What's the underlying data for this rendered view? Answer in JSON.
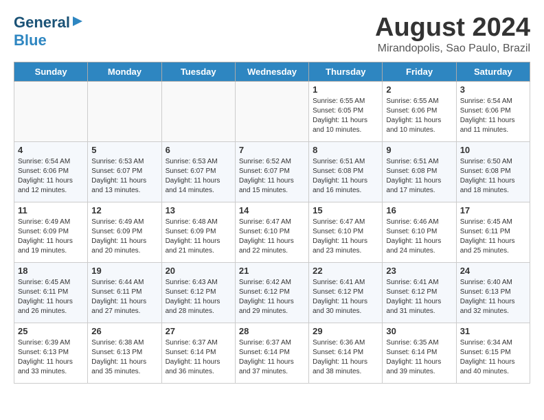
{
  "logo": {
    "line1": "General",
    "line2": "Blue"
  },
  "title": "August 2024",
  "location": "Mirandopolis, Sao Paulo, Brazil",
  "days_of_week": [
    "Sunday",
    "Monday",
    "Tuesday",
    "Wednesday",
    "Thursday",
    "Friday",
    "Saturday"
  ],
  "weeks": [
    [
      {
        "num": "",
        "info": ""
      },
      {
        "num": "",
        "info": ""
      },
      {
        "num": "",
        "info": ""
      },
      {
        "num": "",
        "info": ""
      },
      {
        "num": "1",
        "info": "Sunrise: 6:55 AM\nSunset: 6:05 PM\nDaylight: 11 hours\nand 10 minutes."
      },
      {
        "num": "2",
        "info": "Sunrise: 6:55 AM\nSunset: 6:06 PM\nDaylight: 11 hours\nand 10 minutes."
      },
      {
        "num": "3",
        "info": "Sunrise: 6:54 AM\nSunset: 6:06 PM\nDaylight: 11 hours\nand 11 minutes."
      }
    ],
    [
      {
        "num": "4",
        "info": "Sunrise: 6:54 AM\nSunset: 6:06 PM\nDaylight: 11 hours\nand 12 minutes."
      },
      {
        "num": "5",
        "info": "Sunrise: 6:53 AM\nSunset: 6:07 PM\nDaylight: 11 hours\nand 13 minutes."
      },
      {
        "num": "6",
        "info": "Sunrise: 6:53 AM\nSunset: 6:07 PM\nDaylight: 11 hours\nand 14 minutes."
      },
      {
        "num": "7",
        "info": "Sunrise: 6:52 AM\nSunset: 6:07 PM\nDaylight: 11 hours\nand 15 minutes."
      },
      {
        "num": "8",
        "info": "Sunrise: 6:51 AM\nSunset: 6:08 PM\nDaylight: 11 hours\nand 16 minutes."
      },
      {
        "num": "9",
        "info": "Sunrise: 6:51 AM\nSunset: 6:08 PM\nDaylight: 11 hours\nand 17 minutes."
      },
      {
        "num": "10",
        "info": "Sunrise: 6:50 AM\nSunset: 6:08 PM\nDaylight: 11 hours\nand 18 minutes."
      }
    ],
    [
      {
        "num": "11",
        "info": "Sunrise: 6:49 AM\nSunset: 6:09 PM\nDaylight: 11 hours\nand 19 minutes."
      },
      {
        "num": "12",
        "info": "Sunrise: 6:49 AM\nSunset: 6:09 PM\nDaylight: 11 hours\nand 20 minutes."
      },
      {
        "num": "13",
        "info": "Sunrise: 6:48 AM\nSunset: 6:09 PM\nDaylight: 11 hours\nand 21 minutes."
      },
      {
        "num": "14",
        "info": "Sunrise: 6:47 AM\nSunset: 6:10 PM\nDaylight: 11 hours\nand 22 minutes."
      },
      {
        "num": "15",
        "info": "Sunrise: 6:47 AM\nSunset: 6:10 PM\nDaylight: 11 hours\nand 23 minutes."
      },
      {
        "num": "16",
        "info": "Sunrise: 6:46 AM\nSunset: 6:10 PM\nDaylight: 11 hours\nand 24 minutes."
      },
      {
        "num": "17",
        "info": "Sunrise: 6:45 AM\nSunset: 6:11 PM\nDaylight: 11 hours\nand 25 minutes."
      }
    ],
    [
      {
        "num": "18",
        "info": "Sunrise: 6:45 AM\nSunset: 6:11 PM\nDaylight: 11 hours\nand 26 minutes."
      },
      {
        "num": "19",
        "info": "Sunrise: 6:44 AM\nSunset: 6:11 PM\nDaylight: 11 hours\nand 27 minutes."
      },
      {
        "num": "20",
        "info": "Sunrise: 6:43 AM\nSunset: 6:12 PM\nDaylight: 11 hours\nand 28 minutes."
      },
      {
        "num": "21",
        "info": "Sunrise: 6:42 AM\nSunset: 6:12 PM\nDaylight: 11 hours\nand 29 minutes."
      },
      {
        "num": "22",
        "info": "Sunrise: 6:41 AM\nSunset: 6:12 PM\nDaylight: 11 hours\nand 30 minutes."
      },
      {
        "num": "23",
        "info": "Sunrise: 6:41 AM\nSunset: 6:12 PM\nDaylight: 11 hours\nand 31 minutes."
      },
      {
        "num": "24",
        "info": "Sunrise: 6:40 AM\nSunset: 6:13 PM\nDaylight: 11 hours\nand 32 minutes."
      }
    ],
    [
      {
        "num": "25",
        "info": "Sunrise: 6:39 AM\nSunset: 6:13 PM\nDaylight: 11 hours\nand 33 minutes."
      },
      {
        "num": "26",
        "info": "Sunrise: 6:38 AM\nSunset: 6:13 PM\nDaylight: 11 hours\nand 35 minutes."
      },
      {
        "num": "27",
        "info": "Sunrise: 6:37 AM\nSunset: 6:14 PM\nDaylight: 11 hours\nand 36 minutes."
      },
      {
        "num": "28",
        "info": "Sunrise: 6:37 AM\nSunset: 6:14 PM\nDaylight: 11 hours\nand 37 minutes."
      },
      {
        "num": "29",
        "info": "Sunrise: 6:36 AM\nSunset: 6:14 PM\nDaylight: 11 hours\nand 38 minutes."
      },
      {
        "num": "30",
        "info": "Sunrise: 6:35 AM\nSunset: 6:14 PM\nDaylight: 11 hours\nand 39 minutes."
      },
      {
        "num": "31",
        "info": "Sunrise: 6:34 AM\nSunset: 6:15 PM\nDaylight: 11 hours\nand 40 minutes."
      }
    ]
  ]
}
